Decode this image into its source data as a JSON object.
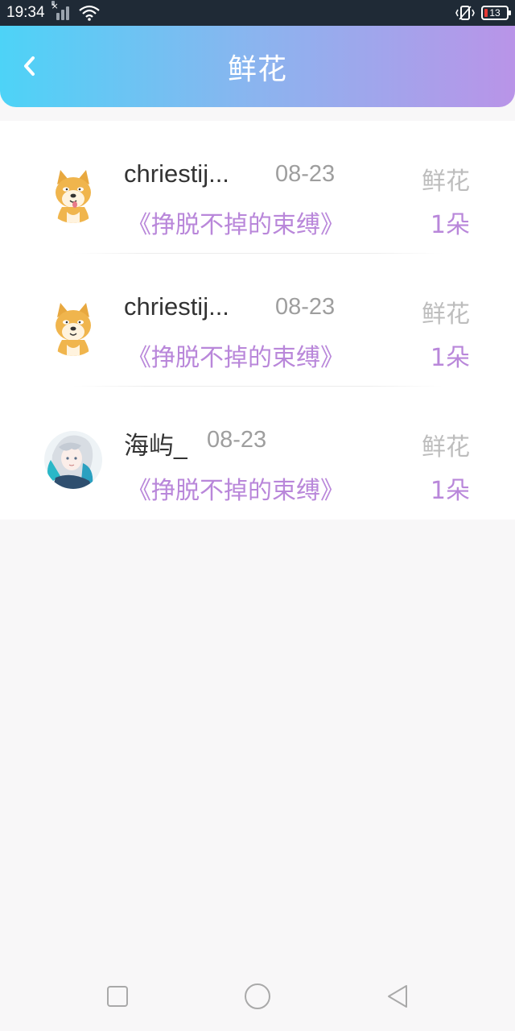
{
  "status_bar": {
    "time": "19:34",
    "battery_level": "13",
    "battery_color": "#e53935"
  },
  "header": {
    "title": "鲜花",
    "back_icon": "chevron-left-icon",
    "gradient": [
      "#4dd3f7",
      "#8bb4ef",
      "#b994e8"
    ]
  },
  "records": [
    {
      "user": "chriestij...",
      "date": "08-23",
      "type": "鲜花",
      "book": "《挣脱不掉的束缚》",
      "count": "1朵",
      "avatar": "shiba-dog-avatar"
    },
    {
      "user": "chriestij...",
      "date": "08-23",
      "type": "鲜花",
      "book": "《挣脱不掉的束缚》",
      "count": "1朵",
      "avatar": "shiba-dog-avatar"
    },
    {
      "user": "海屿_",
      "date": "08-23",
      "type": "鲜花",
      "book": "《挣脱不掉的束缚》",
      "count": "1朵",
      "avatar": "anime-character-avatar"
    }
  ],
  "colors": {
    "accent": "#b987da",
    "muted": "#9e9e9e"
  },
  "nav": {
    "icons": [
      "square-recents-icon",
      "circle-home-icon",
      "triangle-back-icon"
    ]
  }
}
